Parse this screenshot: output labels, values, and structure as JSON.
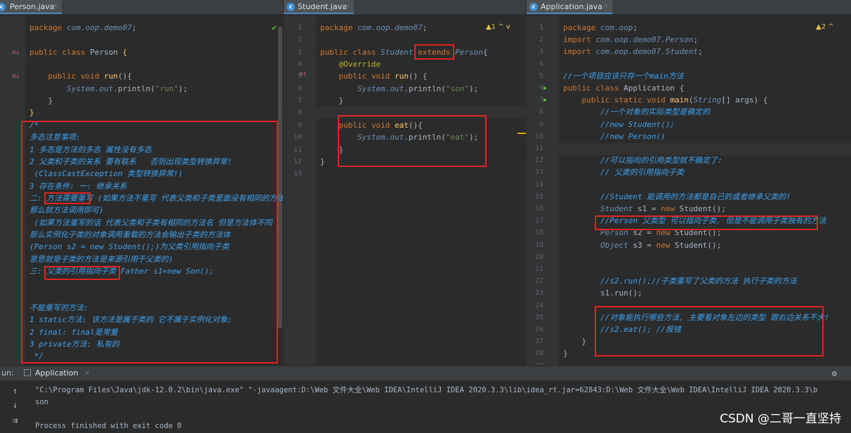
{
  "tabs": {
    "person": "Person.java",
    "student": "Student.java",
    "application": "Application.java"
  },
  "person": {
    "lines": [
      {
        "ln": "",
        "parts": [
          [
            "kw",
            "package "
          ],
          [
            "cls",
            "com.oop.demo07"
          ],
          [
            "pl",
            ";"
          ]
        ]
      },
      {
        "ln": "",
        "parts": []
      },
      {
        "ln": "",
        "parts": [
          [
            "kw",
            "public class "
          ],
          [
            "pl",
            "Person "
          ],
          [
            "fn",
            "{"
          ]
        ]
      },
      {
        "ln": "",
        "parts": []
      },
      {
        "ln": "",
        "parts": [
          [
            "kw",
            "    public void "
          ],
          [
            "fn",
            "run"
          ],
          [
            "pl",
            "(){"
          ]
        ]
      },
      {
        "ln": "",
        "parts": [
          [
            "cls",
            "        System."
          ],
          [
            "cls",
            "out"
          ],
          [
            "pl",
            ".println("
          ],
          [
            "str",
            "\"run\""
          ],
          [
            "pl",
            ");"
          ]
        ]
      },
      {
        "ln": "",
        "parts": [
          [
            "pl",
            "    }"
          ]
        ]
      },
      {
        "ln": "",
        "parts": [
          [
            "fn",
            "}"
          ]
        ]
      },
      {
        "ln": "",
        "parts": [
          [
            "com",
            "/*"
          ]
        ]
      },
      {
        "ln": "",
        "parts": [
          [
            "com",
            "多态注意事项:"
          ]
        ]
      },
      {
        "ln": "",
        "parts": [
          [
            "com",
            "1 多态是方法的多态 属性没有多态"
          ]
        ]
      },
      {
        "ln": "",
        "parts": [
          [
            "com",
            "2 父类和子类的关系 要有联系   否则出现类型转换异常!"
          ]
        ]
      },
      {
        "ln": "",
        "parts": [
          [
            "com",
            " (ClassCastException 类型转换异常!)"
          ]
        ]
      },
      {
        "ln": "",
        "parts": [
          [
            "com",
            "3 存在条件: 一: 继承关系"
          ]
        ]
      },
      {
        "ln": "",
        "parts": [
          [
            "com",
            "二: 方法需要重写 (如果方法不重写 代表父类和子类里面没有相同的方法"
          ]
        ]
      },
      {
        "ln": "",
        "parts": [
          [
            "com",
            "那么就方法调用即可)"
          ]
        ]
      },
      {
        "ln": "",
        "parts": [
          [
            "com",
            " (如果方法重写的话 代表父类和子类有相同的方法名 但是方法体不同"
          ]
        ]
      },
      {
        "ln": "",
        "parts": [
          [
            "com",
            "那么实例化子类的对象调用重载的方法会输出子类的方法体"
          ]
        ]
      },
      {
        "ln": "",
        "parts": [
          [
            "com",
            "(Person s2 = new Student();)为父类引用指向子类"
          ]
        ]
      },
      {
        "ln": "",
        "parts": [
          [
            "com",
            "意思就是子类的方法是来源引用于父类的)"
          ]
        ]
      },
      {
        "ln": "",
        "parts": [
          [
            "com",
            "三: 父类的引用指向子类 Father s1=new Son();"
          ]
        ]
      },
      {
        "ln": "",
        "parts": []
      },
      {
        "ln": "",
        "parts": []
      },
      {
        "ln": "",
        "parts": [
          [
            "com",
            "不能重写的方法:"
          ]
        ]
      },
      {
        "ln": "",
        "parts": [
          [
            "com",
            "1 static方法: 该方法是属于类的 它不属于实例化对象;"
          ]
        ]
      },
      {
        "ln": "",
        "parts": [
          [
            "com",
            "2 final: final是常量"
          ]
        ]
      },
      {
        "ln": "",
        "parts": [
          [
            "com",
            "3 private方法: 私有的"
          ]
        ]
      },
      {
        "ln": "",
        "parts": [
          [
            "com",
            " */"
          ]
        ]
      }
    ]
  },
  "student": {
    "warn": "▲1 ^ v",
    "lines": [
      {
        "ln": "1",
        "parts": [
          [
            "kw",
            "package "
          ],
          [
            "cls",
            "com.oop.demo07"
          ],
          [
            "pl",
            ";"
          ]
        ]
      },
      {
        "ln": "2",
        "parts": []
      },
      {
        "ln": "3",
        "parts": [
          [
            "kw",
            "public class "
          ],
          [
            "cls",
            "Student "
          ],
          [
            "kw",
            "extends "
          ],
          [
            "cls",
            "Person"
          ],
          [
            "pl",
            "{"
          ]
        ]
      },
      {
        "ln": "4",
        "parts": [
          [
            "ann",
            "    @Override"
          ]
        ]
      },
      {
        "ln": "5",
        "parts": [
          [
            "kw",
            "    public void "
          ],
          [
            "fn",
            "run"
          ],
          [
            "pl",
            "() {"
          ]
        ]
      },
      {
        "ln": "6",
        "parts": [
          [
            "cls",
            "        System."
          ],
          [
            "cls",
            "out"
          ],
          [
            "pl",
            ".println("
          ],
          [
            "str",
            "\"son\""
          ],
          [
            "pl",
            ");"
          ]
        ]
      },
      {
        "ln": "7",
        "parts": [
          [
            "pl",
            "    }"
          ]
        ]
      },
      {
        "ln": "8",
        "parts": []
      },
      {
        "ln": "9",
        "parts": [
          [
            "kw",
            "    public void "
          ],
          [
            "fn",
            "eat"
          ],
          [
            "pl",
            "(){"
          ]
        ]
      },
      {
        "ln": "10",
        "parts": [
          [
            "cls",
            "        System."
          ],
          [
            "cls",
            "out"
          ],
          [
            "pl",
            ".println("
          ],
          [
            "str",
            "\"eat\""
          ],
          [
            "pl",
            ");"
          ]
        ]
      },
      {
        "ln": "11",
        "parts": [
          [
            "pl",
            "    }"
          ]
        ]
      },
      {
        "ln": "12",
        "parts": [
          [
            "pl",
            "}"
          ]
        ]
      },
      {
        "ln": "13",
        "parts": []
      }
    ]
  },
  "application": {
    "warn": "▲2 ^",
    "lines": [
      {
        "ln": "1",
        "parts": [
          [
            "kw",
            "package "
          ],
          [
            "cls",
            "com.oop"
          ],
          [
            "pl",
            ";"
          ]
        ]
      },
      {
        "ln": "2",
        "parts": [
          [
            "kw",
            "import "
          ],
          [
            "cls",
            "com.oop.demo07.Person"
          ],
          [
            "pl",
            ";"
          ]
        ]
      },
      {
        "ln": "3",
        "parts": [
          [
            "kw",
            "import "
          ],
          [
            "cls",
            "com.oop.demo07.Student"
          ],
          [
            "pl",
            ";"
          ]
        ]
      },
      {
        "ln": "4",
        "parts": []
      },
      {
        "ln": "5",
        "parts": [
          [
            "com",
            "//一个项目应该只存一个main方法"
          ]
        ]
      },
      {
        "ln": "6",
        "parts": [
          [
            "kw",
            "public class "
          ],
          [
            "pl",
            "Application {"
          ]
        ]
      },
      {
        "ln": "7",
        "parts": [
          [
            "kw",
            "    public static void "
          ],
          [
            "fn",
            "main"
          ],
          [
            "pl",
            "("
          ],
          [
            "cls",
            "String"
          ],
          [
            "pl",
            "[] args) {"
          ]
        ]
      },
      {
        "ln": "8",
        "parts": [
          [
            "com",
            "        //一个对象的实际类型是确定的"
          ]
        ]
      },
      {
        "ln": "9",
        "parts": [
          [
            "com",
            "        //new Student();"
          ]
        ]
      },
      {
        "ln": "10",
        "parts": [
          [
            "com",
            "        //new Person()"
          ]
        ]
      },
      {
        "ln": "11",
        "parts": []
      },
      {
        "ln": "12",
        "parts": [
          [
            "com",
            "        //可以指向的引用类型就不确定了:"
          ]
        ]
      },
      {
        "ln": "13",
        "parts": [
          [
            "com",
            "        // 父类的引用指向子类"
          ]
        ]
      },
      {
        "ln": "14",
        "parts": []
      },
      {
        "ln": "15",
        "parts": [
          [
            "com",
            "        //Student 能调用的方法都是自己的或者继承父类的!"
          ]
        ]
      },
      {
        "ln": "16",
        "parts": [
          [
            "cls",
            "        Student "
          ],
          [
            "pl",
            "s1 = "
          ],
          [
            "kw",
            "new "
          ],
          [
            "pl",
            "Student();"
          ]
        ]
      },
      {
        "ln": "17",
        "parts": [
          [
            "com",
            "        //Person 父类型 可以指向子类, 但是不能调用子类独有的方法"
          ]
        ]
      },
      {
        "ln": "18",
        "parts": [
          [
            "cls",
            "        Person "
          ],
          [
            "pl",
            "s2 = "
          ],
          [
            "kw",
            "new "
          ],
          [
            "pl",
            "Student();"
          ]
        ]
      },
      {
        "ln": "19",
        "parts": [
          [
            "cls",
            "        Object "
          ],
          [
            "pl",
            "s3 = "
          ],
          [
            "kw",
            "new "
          ],
          [
            "pl",
            "Student();"
          ]
        ]
      },
      {
        "ln": "20",
        "parts": []
      },
      {
        "ln": "21",
        "parts": []
      },
      {
        "ln": "22",
        "parts": [
          [
            "com",
            "        //s2.run();//子类重写了父类的方法 执行子类的方法"
          ]
        ]
      },
      {
        "ln": "23",
        "parts": [
          [
            "pl",
            "        s1.run();"
          ]
        ]
      },
      {
        "ln": "24",
        "parts": []
      },
      {
        "ln": "25",
        "parts": [
          [
            "com",
            "        //对象能执行哪些方法, 主要看对象左边的类型 跟右边关系不大!"
          ]
        ]
      },
      {
        "ln": "26",
        "parts": [
          [
            "com",
            "        //s2.eat(); //报错"
          ]
        ]
      },
      {
        "ln": "27",
        "parts": [
          [
            "pl",
            "    }"
          ]
        ]
      },
      {
        "ln": "28",
        "parts": [
          [
            "pl",
            "}"
          ]
        ]
      },
      {
        "ln": "29",
        "parts": []
      }
    ]
  },
  "run": {
    "label": "un:",
    "tab": "Application",
    "cmd": "\"C:\\Program Files\\Java\\jdk-12.0.2\\bin\\java.exe\" \"-javaagent:D:\\Web 文件大全\\Web IDEA\\IntelliJ IDEA 2020.3.3\\lib\\idea_rt.jar=62843:D:\\Web 文件大全\\Web IDEA\\IntelliJ IDEA 2020.3.3\\b",
    "out": "son",
    "exit": "Process finished with exit code 0"
  },
  "watermark": "CSDN @二哥一直坚持"
}
